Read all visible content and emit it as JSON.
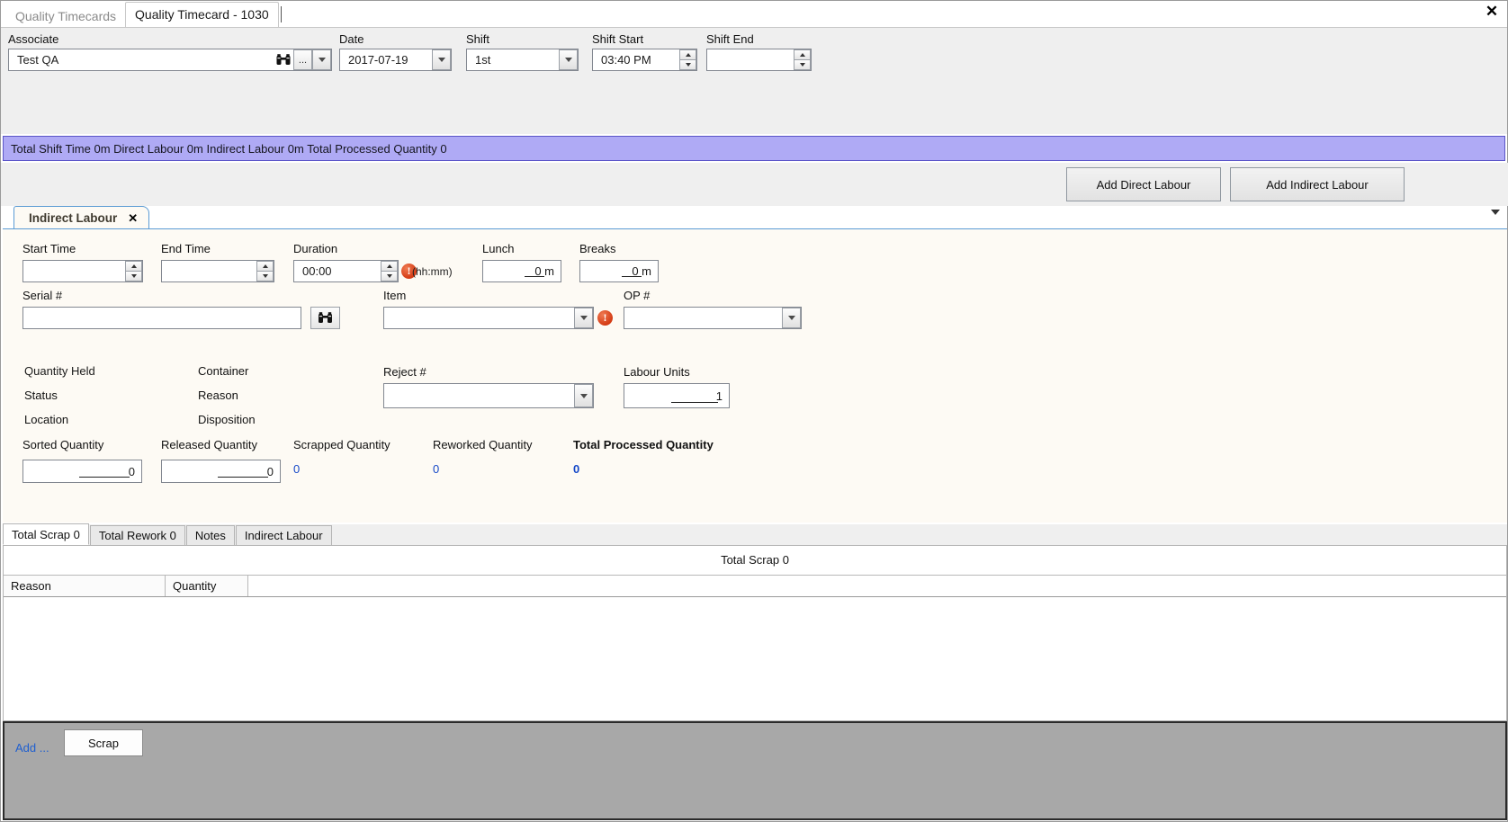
{
  "window": {
    "close_label": "✕"
  },
  "top_tabs": [
    {
      "label": "Quality Timecards",
      "active": false
    },
    {
      "label": "Quality Timecard - 1030",
      "active": true
    }
  ],
  "header": {
    "associate": {
      "label": "Associate",
      "value": "Test QA",
      "ellipsis_label": "...",
      "search_icon": "binoculars-icon"
    },
    "date": {
      "label": "Date",
      "value": "2017-07-19"
    },
    "shift": {
      "label": "Shift",
      "value": "1st"
    },
    "shift_start": {
      "label": "Shift Start",
      "value": "03:40 PM"
    },
    "shift_end": {
      "label": "Shift End",
      "value": ""
    }
  },
  "summary": {
    "text": "Total Shift Time 0m  Direct Labour 0m  Indirect Labour 0m  Total Processed Quantity 0",
    "background": "#afaaf5"
  },
  "actions": {
    "add_direct": "Add Direct Labour",
    "add_indirect": "Add Indirect Labour"
  },
  "inner_tab": {
    "label": "Indirect Labour",
    "close": "✕"
  },
  "form": {
    "start_time": {
      "label": "Start Time",
      "value": ""
    },
    "end_time": {
      "label": "End Time",
      "value": ""
    },
    "duration": {
      "label": "Duration",
      "value": "00:00",
      "hint": "(hh:mm)",
      "error": "!"
    },
    "lunch": {
      "label": "Lunch",
      "value": "0 m"
    },
    "breaks": {
      "label": "Breaks",
      "value": "0 m"
    },
    "serial": {
      "label": "Serial #",
      "value": ""
    },
    "item": {
      "label": "Item",
      "value": "",
      "error": "!"
    },
    "op": {
      "label": "OP #",
      "value": ""
    },
    "quantity_held": {
      "label": "Quantity Held"
    },
    "container": {
      "label": "Container"
    },
    "reject": {
      "label": "Reject #",
      "value": ""
    },
    "labour_units": {
      "label": "Labour Units",
      "value": "1"
    },
    "status": {
      "label": "Status"
    },
    "reason": {
      "label": "Reason"
    },
    "location": {
      "label": "Location"
    },
    "disposition": {
      "label": "Disposition"
    },
    "sorted_quantity": {
      "label": "Sorted Quantity",
      "value": "0"
    },
    "released_quantity": {
      "label": "Released Quantity",
      "value": "0"
    },
    "scrapped_quantity": {
      "label": "Scrapped Quantity",
      "value": "0"
    },
    "reworked_quantity": {
      "label": "Reworked Quantity",
      "value": "0"
    },
    "total_processed_quantity": {
      "label": "Total Processed Quantity",
      "value": "0"
    }
  },
  "bottom_tabs": [
    {
      "label": "Total Scrap 0",
      "active": true
    },
    {
      "label": "Total Rework 0",
      "active": false
    },
    {
      "label": "Notes",
      "active": false
    },
    {
      "label": "Indirect Labour",
      "active": false
    }
  ],
  "grid": {
    "title": "Total Scrap 0",
    "columns": [
      "Reason",
      "Quantity"
    ],
    "rows": []
  },
  "bottom_bar": {
    "add_label": "Add ...",
    "scrap_label": "Scrap"
  },
  "colors": {
    "accent_blue": "#1548c8",
    "summary_purple": "#afaaf5",
    "tab_border_blue": "#5b9bd5"
  }
}
